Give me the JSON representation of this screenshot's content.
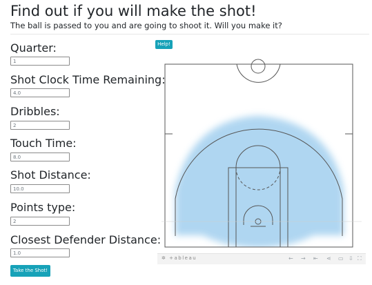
{
  "header": {
    "title": "Find out if you will make the shot!",
    "subtitle": "The ball is passed to you and are going to shoot it. Will you make it?"
  },
  "form": {
    "fields": [
      {
        "label": "Quarter:",
        "value": "1"
      },
      {
        "label": "Shot Clock Time Remaining:",
        "value": "4.0"
      },
      {
        "label": "Dribbles:",
        "value": "2"
      },
      {
        "label": "Touch Time:",
        "value": "8.0"
      },
      {
        "label": "Shot Distance:",
        "value": "10.0"
      },
      {
        "label": "Points type:",
        "value": "2"
      },
      {
        "label": "Closest Defender Distance:",
        "value": "1.0"
      }
    ],
    "submit_label": "Take the Shot!"
  },
  "help_label": "Help!",
  "viz": {
    "logo_text": "+ableau",
    "icons": [
      "plus-logo-icon",
      "undo-icon",
      "redo-icon",
      "revert-icon",
      "share-icon",
      "comment-icon",
      "download-icon",
      "fullscreen-icon"
    ]
  },
  "colors": {
    "accent": "#17a2b8",
    "shot_density": "#a9d3f0",
    "court_lines": "#555555"
  }
}
